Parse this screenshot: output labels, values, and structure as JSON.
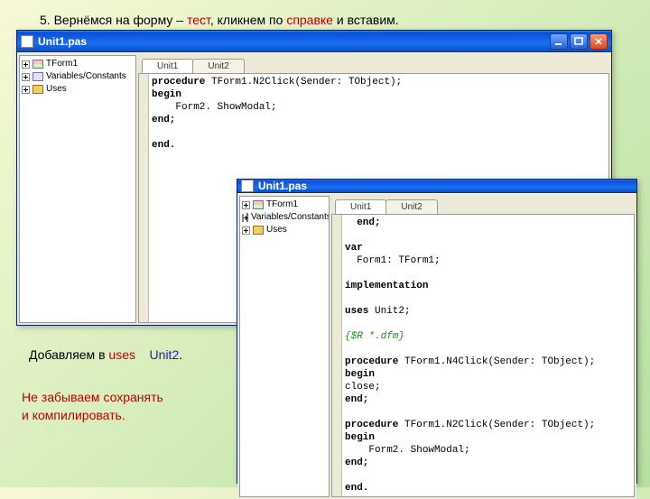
{
  "slide": {
    "line1a": "5. Вернёмся на форму – ",
    "line1_test": "тест",
    "line1b": ", кликнем по ",
    "line1_sprav": "справке",
    "line1c": " и вставим.",
    "line2a": "Добавляем в ",
    "line2_uses": "uses",
    "line2_unit2": "Unit2",
    "line2b": ".",
    "line3a": "Не забываем сохранять",
    "line3b": "и компилировать."
  },
  "win1": {
    "title": "Unit1.pas",
    "tabs": [
      "Unit1",
      "Unit2"
    ],
    "tree": [
      {
        "icon": "form",
        "label": "TForm1"
      },
      {
        "icon": "vars",
        "label": "Variables/Constants"
      },
      {
        "icon": "folder",
        "label": "Uses"
      }
    ],
    "code": {
      "l1a": "procedure",
      "l1b": " TForm1.N2Click(Sender: TObject);",
      "l2": "begin",
      "l3": "    Form2. ShowModal;",
      "l4": "end;",
      "l5": "",
      "l6": "end."
    }
  },
  "win2": {
    "title": "Unit1.pas",
    "tabs": [
      "Unit1",
      "Unit2"
    ],
    "tree": [
      {
        "icon": "form",
        "label": "TForm1"
      },
      {
        "icon": "vars",
        "label": "Variables/Constants"
      },
      {
        "icon": "folder",
        "label": "Uses"
      }
    ],
    "code": {
      "l1": "  end;",
      "l2": "",
      "l3": "var",
      "l4": "  Form1: TForm1;",
      "l5": "",
      "l6": "implementation",
      "l7": "",
      "l8a": "uses",
      "l8b": " Unit2;",
      "l9": "",
      "l10": "{$R *.dfm}",
      "l11": "",
      "l12a": "procedure",
      "l12b": " TForm1.N4Click(Sender: TObject);",
      "l13": "begin",
      "l14": "close;",
      "l15": "end;",
      "l16": "",
      "l17a": "procedure",
      "l17b": " TForm1.N2Click(Sender: TObject);",
      "l18": "begin",
      "l19": "    Form2. ShowModal;",
      "l20": "end;",
      "l21": "",
      "l22": "end."
    }
  }
}
